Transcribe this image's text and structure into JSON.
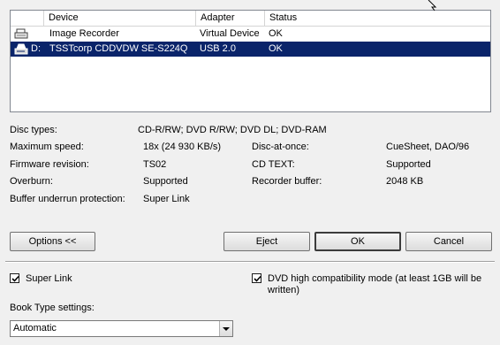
{
  "device_list": {
    "columns": [
      "Device",
      "Adapter",
      "Status"
    ],
    "rows": [
      {
        "icon": "recorder-icon",
        "drive": "",
        "device": "Image Recorder",
        "adapter": "Virtual Device",
        "status": "OK",
        "selected": false
      },
      {
        "icon": "optical-drive-icon",
        "drive": "D:",
        "device": "TSSTcorp CDDVDW SE-S224Q",
        "adapter": "USB 2.0",
        "status": "OK",
        "selected": true
      }
    ]
  },
  "properties": {
    "disc_types": {
      "label": "Disc types:",
      "value": "CD-R/RW; DVD R/RW; DVD DL; DVD-RAM"
    },
    "max_speed": {
      "label": "Maximum speed:",
      "value": "18x (24 930 KB/s)"
    },
    "firmware": {
      "label": "Firmware revision:",
      "value": "TS02"
    },
    "overburn": {
      "label": "Overburn:",
      "value": "Supported"
    },
    "buffer_protection": {
      "label": "Buffer underrun protection:",
      "value": "Super Link"
    },
    "disc_at_once": {
      "label": "Disc-at-once:",
      "value": "CueSheet, DAO/96"
    },
    "cd_text": {
      "label": "CD TEXT:",
      "value": "Supported"
    },
    "recorder_buffer": {
      "label": "Recorder buffer:",
      "value": "2048 KB"
    }
  },
  "buttons": {
    "options": "Options <<",
    "eject": "Eject",
    "ok": "OK",
    "cancel": "Cancel"
  },
  "options": {
    "super_link": {
      "label": "Super Link",
      "checked": true
    },
    "dvd_high_compat": {
      "label_line1": "DVD high compatibility mode (at least 1GB will be",
      "label_line2": "written)",
      "checked": true
    },
    "book_type": {
      "label": "Book Type settings:",
      "value": "Automatic"
    }
  }
}
